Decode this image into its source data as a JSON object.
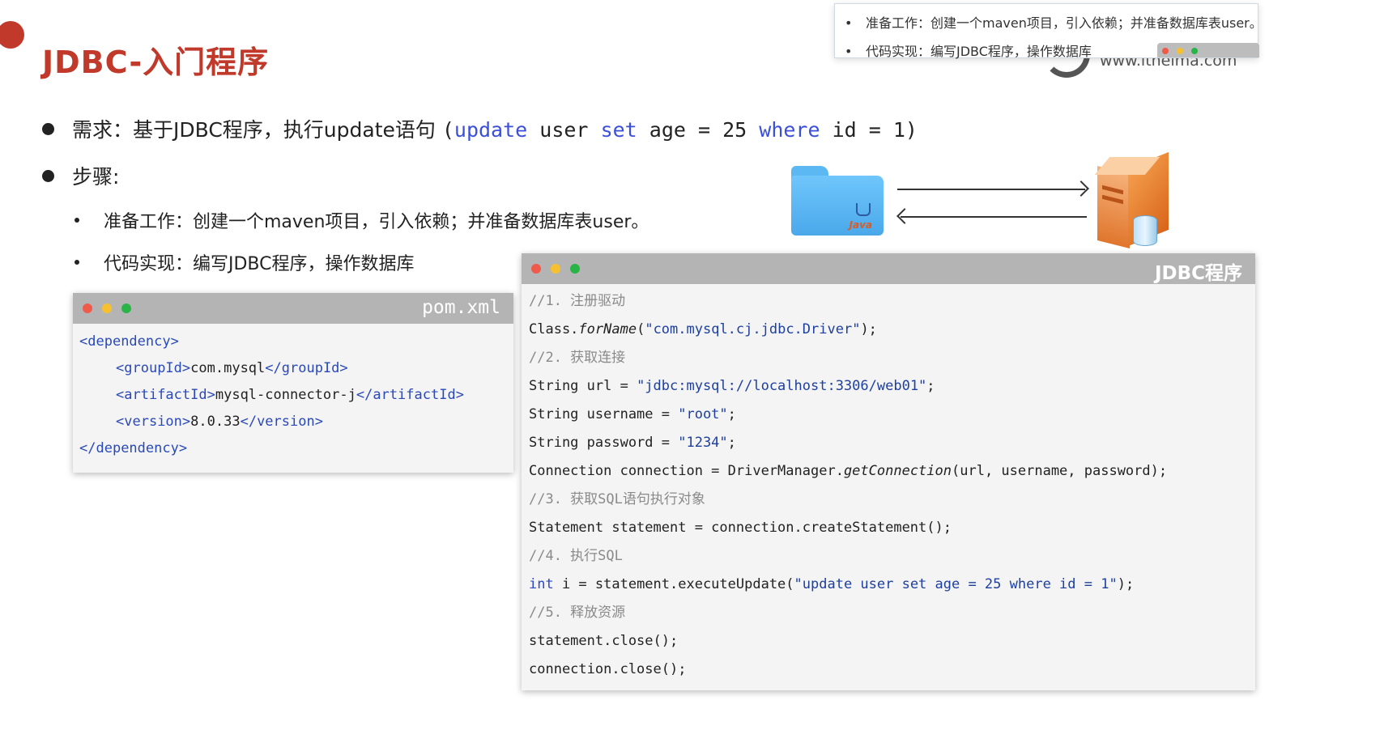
{
  "page": {
    "title": "JDBC-入门程序"
  },
  "brand": {
    "url_text": "www.itheima.com"
  },
  "tooltip": {
    "items": [
      "准备工作：创建一个maven项目，引入依赖；并准备数据库表user。",
      "代码实现：编写JDBC程序，操作数据库"
    ]
  },
  "bullets": {
    "requirement_prefix": "需求：基于JDBC程序，执行update语句",
    "sql": {
      "open": "(",
      "update": "update",
      "user": "user",
      "set": "set",
      "rest": "age = 25",
      "where": "where",
      "cond": "id = 1",
      "close": ")"
    },
    "steps_label": "步骤:",
    "sub_items": [
      "准备工作：创建一个maven项目，引入依赖；并准备数据库表user。",
      "代码实现：编写JDBC程序，操作数据库"
    ]
  },
  "diagram": {
    "java_label": "Java"
  },
  "pom_window": {
    "title": "pom.xml",
    "lines": {
      "l1_open": "<",
      "l1_tag": "dependency",
      "l1_close": ">",
      "l2_tag_open": "groupId",
      "l2_value": "com.mysql",
      "l2_tag_close": "groupId",
      "l3_tag_open": "artifactId",
      "l3_value": "mysql-connector-j",
      "l3_tag_close": "artifactId",
      "l4_tag_open": "version",
      "l4_value": "8.0.33",
      "l4_tag_close": "version",
      "l5_tag": "dependency"
    }
  },
  "jdbc_window": {
    "title": "JDBC程序",
    "code": {
      "c1": "//1. 注册驱动",
      "l2a": "Class.",
      "l2b": "forName",
      "l2c": "(",
      "l2d": "\"com.mysql.cj.jdbc.Driver\"",
      "l2e": ");",
      "c3": "//2. 获取连接",
      "l4a": "String url = ",
      "l4b": "\"jdbc:mysql://localhost:3306/web01\"",
      "l4c": ";",
      "l5a": "String username = ",
      "l5b": "\"root\"",
      "l5c": ";",
      "l6a": "String password = ",
      "l6b": "\"1234\"",
      "l6c": ";",
      "l7a": "Connection connection = DriverManager.",
      "l7b": "getConnection",
      "l7c": "(url, username, password);",
      "c8": "//3. 获取SQL语句执行对象",
      "l9": "Statement statement = connection.createStatement();",
      "c10": "//4. 执行SQL",
      "l11a": "int",
      "l11b": " i = statement.executeUpdate(",
      "l11c": "\"update user set age = 25 where id = 1\"",
      "l11d": ");",
      "c12": "//5. 释放资源",
      "l13": "statement.close();",
      "l14": "connection.close();"
    }
  },
  "colors": {
    "title_red": "#c0392b",
    "keyword_blue": "#3b4fd8",
    "xml_tag_blue": "#2a49b8",
    "comment_gray": "#8a8a8a",
    "window_bar_gray": "#b4b4b4"
  },
  "icons": [
    "java-folder-icon",
    "server-icon",
    "database-icon",
    "arrow-right-icon",
    "arrow-left-icon"
  ]
}
